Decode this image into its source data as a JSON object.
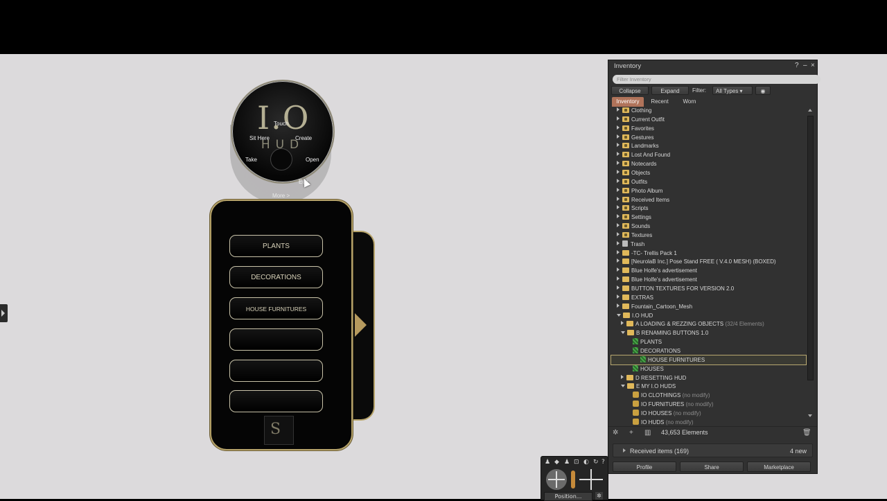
{
  "hud": {
    "pie": {
      "logo_top": "I.O",
      "logo_bottom": "HUD",
      "touch": "Touch",
      "sit_here": "Sit Here",
      "create": "Create",
      "take": "Take",
      "open": "Open",
      "edit": "Edit",
      "more": "More >"
    },
    "buttons": [
      "PLANTS",
      "DECORATIONS",
      "HOUSE FURNITURES",
      "",
      "",
      ""
    ]
  },
  "inventory": {
    "title": "Inventory",
    "controls": {
      "help": "?",
      "minimize": "–",
      "close": "×"
    },
    "filter_placeholder": "Filter Inventory",
    "toolbar": {
      "collapse": "Collapse",
      "expand": "Expand",
      "filter_label": "Filter:",
      "filter_value": "All Types"
    },
    "tabs": [
      {
        "label": "Inventory",
        "active": true
      },
      {
        "label": "Recent",
        "active": false
      },
      {
        "label": "Worn",
        "active": false
      }
    ],
    "tree": [
      {
        "label": "Clothing",
        "icon": "folder-system",
        "level": 0,
        "expanded": false
      },
      {
        "label": "Current Outfit",
        "icon": "folder-system",
        "level": 0,
        "expanded": false
      },
      {
        "label": "Favorites",
        "icon": "folder-system",
        "level": 0,
        "expanded": false
      },
      {
        "label": "Gestures",
        "icon": "folder-system",
        "level": 0,
        "expanded": false
      },
      {
        "label": "Landmarks",
        "icon": "folder-system",
        "level": 0,
        "expanded": false
      },
      {
        "label": "Lost And Found",
        "icon": "folder-system",
        "level": 0,
        "expanded": false
      },
      {
        "label": "Notecards",
        "icon": "folder-system",
        "level": 0,
        "expanded": false
      },
      {
        "label": "Objects",
        "icon": "folder-system",
        "level": 0,
        "expanded": false
      },
      {
        "label": "Outfits",
        "icon": "folder-system",
        "level": 0,
        "expanded": false
      },
      {
        "label": "Photo Album",
        "icon": "folder-system",
        "level": 0,
        "expanded": false
      },
      {
        "label": "Received Items",
        "icon": "folder-system",
        "level": 0,
        "expanded": false
      },
      {
        "label": "Scripts",
        "icon": "folder-system",
        "level": 0,
        "expanded": false
      },
      {
        "label": "Settings",
        "icon": "folder-system",
        "level": 0,
        "expanded": false
      },
      {
        "label": "Sounds",
        "icon": "folder-system",
        "level": 0,
        "expanded": false
      },
      {
        "label": "Textures",
        "icon": "folder-system",
        "level": 0,
        "expanded": false
      },
      {
        "label": "Trash",
        "icon": "trash",
        "level": 0,
        "expanded": false
      },
      {
        "label": "-TC- Trellis Pack 1",
        "icon": "folder",
        "level": 0,
        "expanded": false
      },
      {
        "label": "[NeurolaB Inc.] Pose Stand FREE ( V.4.0 MESH) (BOXED)",
        "icon": "folder",
        "level": 0,
        "expanded": false
      },
      {
        "label": "Blue Holfe's advertisement",
        "icon": "folder",
        "level": 0,
        "expanded": false
      },
      {
        "label": "Blue Holfe's advertisement",
        "icon": "folder",
        "level": 0,
        "expanded": false
      },
      {
        "label": "BUTTON TEXTURES FOR VERSION 2.0",
        "icon": "folder",
        "level": 0,
        "expanded": false
      },
      {
        "label": "EXTRAS",
        "icon": "folder",
        "level": 0,
        "expanded": false
      },
      {
        "label": "Fountain_Cartoon_Mesh",
        "icon": "folder",
        "level": 0,
        "expanded": false
      },
      {
        "label": "I.O HUD",
        "icon": "folder",
        "level": 0,
        "expanded": true
      },
      {
        "label": "A LOADING & REZZING OBJECTS",
        "suffix": "(32/4 Elements)",
        "icon": "folder",
        "level": 1,
        "expanded": false
      },
      {
        "label": "B RENAMING BUTTONS 1.0",
        "icon": "folder",
        "level": 1,
        "expanded": true
      },
      {
        "label": "PLANTS",
        "icon": "notecard",
        "level": 2
      },
      {
        "label": "DECORATIONS",
        "icon": "notecard",
        "level": 2
      },
      {
        "label": "HOUSE FURNITURES",
        "icon": "notecard",
        "level": 2,
        "selected": true
      },
      {
        "label": "HOUSES",
        "icon": "notecard",
        "level": 2
      },
      {
        "label": "D RESETTING HUD",
        "icon": "folder",
        "level": 1
      },
      {
        "label": "E MY I.O HUDS",
        "icon": "folder",
        "level": 1,
        "expanded": true
      },
      {
        "label": "IO CLOTHINGS",
        "suffix": "(no modify)",
        "icon": "object",
        "level": 2
      },
      {
        "label": "IO FURNITURES",
        "suffix": "(no modify)",
        "icon": "object",
        "level": 2
      },
      {
        "label": "IO HOUSES",
        "suffix": "(no modify)",
        "icon": "object",
        "level": 2
      },
      {
        "label": "IO HUDS",
        "suffix": "(no modify)",
        "icon": "object",
        "level": 2
      }
    ],
    "element_count": "43,653 Elements",
    "received": {
      "label": "Received items (169)",
      "count": "4 new"
    },
    "footer_buttons": [
      "Profile",
      "Share",
      "Marketplace"
    ]
  },
  "camera": {
    "position_label": "Position..."
  },
  "colors": {
    "accent_gold": "#b6a36a",
    "tab_active": "#b0735a",
    "panel_bg": "#313131",
    "scene_bg": "#dcdadc"
  }
}
